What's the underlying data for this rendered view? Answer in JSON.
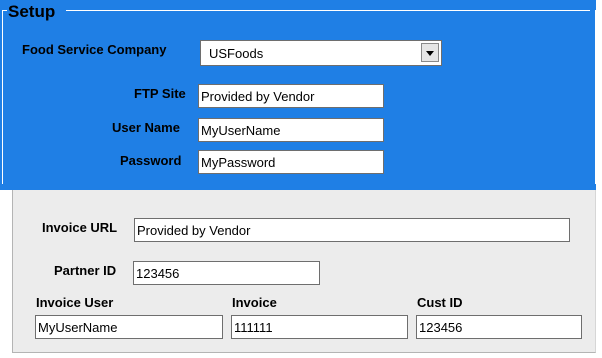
{
  "setup": {
    "legend": "Setup",
    "food_service_company": {
      "label": "Food Service Company",
      "value": "USFoods"
    },
    "ftp_site": {
      "label": "FTP Site",
      "value": "Provided by Vendor"
    },
    "user_name": {
      "label": "User Name",
      "value": "MyUserName"
    },
    "password": {
      "label": "Password",
      "value": "MyPassword"
    }
  },
  "invoice": {
    "invoice_url": {
      "label": "Invoice URL",
      "value": "Provided by Vendor"
    },
    "partner_id": {
      "label": "Partner ID",
      "value": "123456"
    },
    "invoice_user": {
      "label": "Invoice User",
      "value": "MyUserName"
    },
    "invoice": {
      "label": "Invoice",
      "value": "111111"
    },
    "cust_id": {
      "label": "Cust ID",
      "value": "123456"
    }
  },
  "colors": {
    "setup_panel": "#1f7fe5",
    "invoice_panel": "#ececec"
  },
  "icons": {
    "dropdown": "chevron-down-icon"
  }
}
